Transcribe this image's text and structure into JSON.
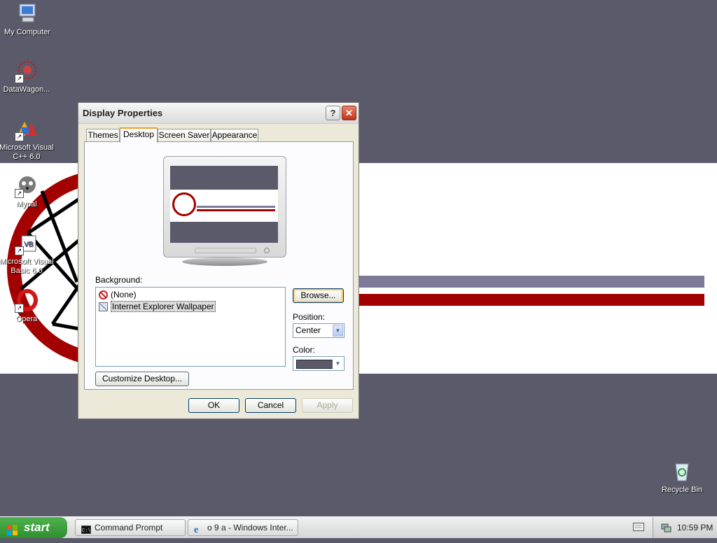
{
  "desktop": {
    "icons": [
      {
        "label": "My Computer",
        "icon": "my-computer-icon"
      },
      {
        "label": "DataWagon...",
        "icon": "datawagon-icon"
      },
      {
        "label": "Microsoft Visual C++ 6.0",
        "icon": "visual-cpp-icon"
      },
      {
        "label": "Mypal",
        "icon": "mypal-icon"
      },
      {
        "label": "Microsoft Visual Basic 6.0",
        "icon": "visual-basic-icon"
      },
      {
        "label": "Opera",
        "icon": "opera-icon"
      },
      {
        "label": "Recycle Bin",
        "icon": "recycle-bin-icon"
      }
    ],
    "colors": {
      "background": "#5b5a6b",
      "stripe_blue": "#7c7a97",
      "stripe_red": "#a30000"
    }
  },
  "dialog": {
    "title": "Display Properties",
    "help_label": "?",
    "close_label": "✕",
    "tabs": [
      "Themes",
      "Desktop",
      "Screen Saver",
      "Appearance"
    ],
    "active_tab": "Desktop",
    "background_label": "Background:",
    "background_items": [
      "(None)",
      "Internet Explorer Wallpaper"
    ],
    "selected_background": "Internet Explorer Wallpaper",
    "browse_label": "Browse...",
    "position_label": "Position:",
    "position_value": "Center",
    "color_label": "Color:",
    "color_value": "#5b5a6b",
    "customize_label": "Customize Desktop...",
    "ok_label": "OK",
    "cancel_label": "Cancel",
    "apply_label": "Apply"
  },
  "taskbar": {
    "start_label": "start",
    "tasks": [
      {
        "label": "Command Prompt",
        "icon": "command-prompt-icon"
      },
      {
        "label": "o 9 a - Windows Inter...",
        "icon": "internet-explorer-icon"
      }
    ],
    "clock": "10:59 PM"
  }
}
